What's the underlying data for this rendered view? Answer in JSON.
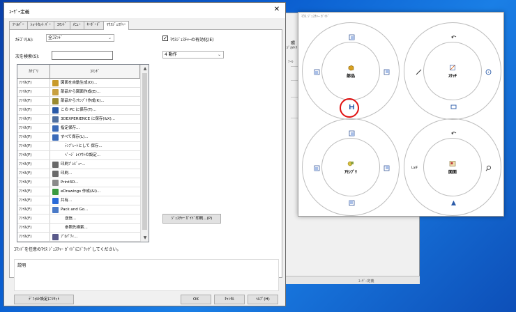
{
  "dialog": {
    "title": "ﾕｰｻﾞｰ定義",
    "close_glyph": "✕",
    "tabs": [
      "ﾂｰﾙﾊﾞｰ",
      "ｼｮｰﾄｶｯﾄ ﾊﾞｰ",
      "ｺﾏﾝﾄﾞ",
      "ﾒﾆｭｰ",
      "ｷｰﾎﾞｰﾄﾞ",
      "ﾏｳｽｼﾞｪｽﾁｬｰ"
    ],
    "active_tab_index": 5
  },
  "panel": {
    "category_label": "ｶﾃｺﾞﾘ(A):",
    "category_value": "全ｺﾏﾝﾄﾞ",
    "search_label": "次を検索(S):",
    "search_value": "",
    "enable_gesture_label": "ﾏｳｽｼﾞｪｽﾁｬｰの有効化(E)",
    "enable_gesture_checked": true,
    "gesture_count_value": "4 動作",
    "print_guide_button": "ｼﾞｪｽﾁｬｰ ｶﾞｲﾄﾞ印刷...(P)",
    "drag_hint": "ｺﾏﾝﾄﾞを任意のﾏｳｽ ｼﾞｪｽﾁｬｰ ｶﾞｲﾄﾞにﾄﾞﾗｯｸﾞしてください。",
    "description_label": "説明"
  },
  "table": {
    "headers": [
      "ｶﾃｺﾞﾘ",
      "ｺﾏﾝﾄﾞ"
    ],
    "rows": [
      {
        "category": "ﾌｧｲﾙ(F)",
        "command": "図面を自動生成(O)...",
        "icon_color": "#c89a2a"
      },
      {
        "category": "ﾌｧｲﾙ(F)",
        "command": "部品から図面作成(E)...",
        "icon_color": "#c8a040"
      },
      {
        "category": "ﾌｧｲﾙ(F)",
        "command": "部品からｱｾﾝﾌﾞﾘ作成(K)...",
        "icon_color": "#9a8a30"
      },
      {
        "category": "ﾌｧｲﾙ(F)",
        "command": "この PC に保存(T)...",
        "icon_color": "#2a5aa8"
      },
      {
        "category": "ﾌｧｲﾙ(F)",
        "command": "3DEXPERIENCE に保存(&X)...",
        "icon_color": "#5070a0"
      },
      {
        "category": "ﾌｧｲﾙ(F)",
        "command": "指定保存...",
        "icon_color": "#3a6ab8"
      },
      {
        "category": "ﾌｧｲﾙ(F)",
        "command": "すべて保存(L)...",
        "icon_color": "#3a6ab8"
      },
      {
        "category": "ﾌｧｲﾙ(F)",
        "command": "ﾃﾝﾌﾟﾚｰﾄとして 保存...",
        "icon_color": ""
      },
      {
        "category": "ﾌｧｲﾙ(F)",
        "command": "ﾍﾟｰｼﾞ ﾚｲｱｳﾄの設定...",
        "icon_color": ""
      },
      {
        "category": "ﾌｧｲﾙ(F)",
        "command": "印刷ﾌﾟﾚﾋﾞｭｰ...",
        "icon_color": "#6a6a6a"
      },
      {
        "category": "ﾌｧｲﾙ(F)",
        "command": "印刷...",
        "icon_color": "#6a6a6a"
      },
      {
        "category": "ﾌｧｲﾙ(F)",
        "command": "Print3D...",
        "icon_color": "#8a8a8a"
      },
      {
        "category": "ﾌｧｲﾙ(F)",
        "command": "eDrawings 作成(&I)...",
        "icon_color": "#3a9a40"
      },
      {
        "category": "ﾌｧｲﾙ(F)",
        "command": "共有...",
        "icon_color": "#2a6ad8"
      },
      {
        "category": "ﾌｧｲﾙ(F)",
        "command": "Pack and Go...",
        "icon_color": "#4a7ac8"
      },
      {
        "category": "ﾌｧｲﾙ(F)",
        "command": "送信...",
        "icon_color": ""
      },
      {
        "category": "ﾌｧｲﾙ(F)",
        "command": "参照先検索...",
        "icon_color": ""
      },
      {
        "category": "ﾌｧｲﾙ(F)",
        "command": "ﾌﾟﾛﾊﾟﾃｨ...",
        "icon_color": "#5a5a8a"
      }
    ]
  },
  "footer": {
    "reset_button": "ﾃﾞﾌｫﾙﾄ設定にﾘｾｯﾄ",
    "ok_button": "OK",
    "cancel_button": "ｷｬﾝｾﾙ",
    "help_button": "ﾍﾙﾌﾟ(H)"
  },
  "guide": {
    "title": "ﾏｳｽ ｼﾞｪｽﾁｬｰ ｶﾞｲﾄﾞ",
    "wheels": [
      {
        "label": "部品"
      },
      {
        "label": "ｽｹｯﾁ"
      },
      {
        "label": "ｱｾﾝﾌﾞﾘ"
      },
      {
        "label": "図面"
      }
    ],
    "smart_dim_text": "LaIF"
  },
  "background_app": {
    "label_top": "照",
    "label_top2": "ｼﾞｵﾒﾄﾘ",
    "label_side": "ﾂｰﾙ",
    "taskbar_text": "ﾕｰｻﾞｰ定義"
  },
  "colors": {
    "accent_red": "#e01010",
    "desktop_blue": "#0b5fd0"
  }
}
